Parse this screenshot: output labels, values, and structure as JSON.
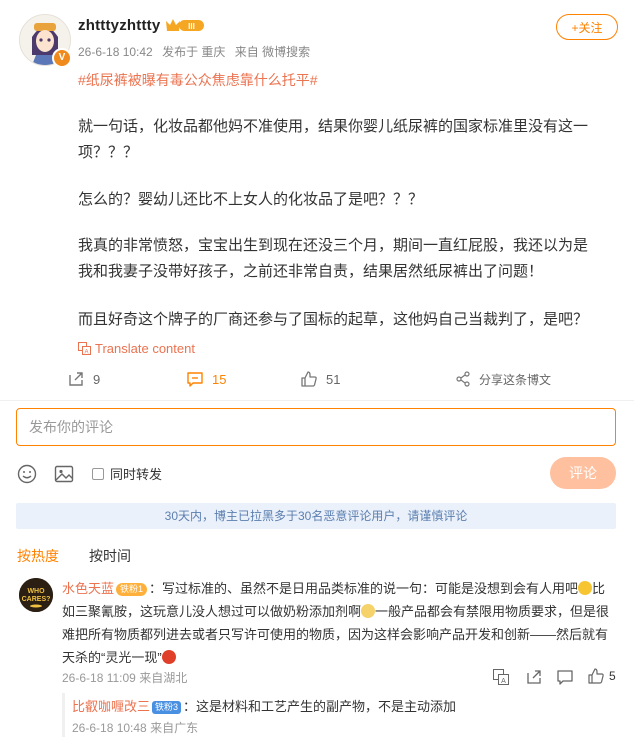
{
  "post": {
    "username": "zhtttyzhttty",
    "level_badge": "III",
    "verified_badge": "V",
    "date": "26-6-18 10:42",
    "location": "发布于 重庆",
    "source": "来自 微博搜索",
    "follow_label": "+关注",
    "hashtag": "#纸尿裤被曝有毒公众焦虑靠什么托平#",
    "paragraphs": [
      "就一句话，化妆品都他妈不准使用，结果你婴儿纸尿裤的国家标准里没有这一项？？？",
      "怎么的？婴幼儿还比不上女人的化妆品了是吧？？？",
      "我真的非常愤怒，宝宝出生到现在还没三个月，期间一直红屁股，我还以为是我和我妻子没带好孩子，之前还非常自责，结果居然纸尿裤出了问题！",
      "而且好奇这个牌子的厂商还参与了国标的起草，这他妈自己当裁判了，是吧？"
    ],
    "translate_label": "Translate content",
    "share_count": "9",
    "comment_count": "15",
    "like_count": "51",
    "share_weibo_label": "分享这条博文"
  },
  "composer": {
    "placeholder": "发布你的评论",
    "repost_label": "同时转发",
    "submit_label": "评论"
  },
  "notice": "30天内，博主已拉黑多于30名恶意评论用户，请谨慎评论",
  "sort": {
    "by_hot": "按热度",
    "by_time": "按时间"
  },
  "comments": [
    {
      "user": "水色天蓝",
      "badge": "铁粉1",
      "text": "：写过标准的、虽然不是日用品类标准的说一句：可能是没想到会有人用吧",
      "text2": "比如三聚氰胺，这玩意儿没人想过可以做奶粉添加剂啊",
      "text3": "一般产品都会有禁限用物质要求，但是很难把所有物质都列进去或者只写许可使用的物质，因为这样会影响产品开发和创新——然后就有天杀的“灵光一现”",
      "date": "26-6-18 11:09",
      "location": "来自湖北",
      "like_count": "5",
      "reply": {
        "user": "比叡咖喱改三",
        "badge": "铁粉3",
        "text": "：这是材料和工艺产生的副产物，不是主动添加",
        "date": "26-6-18 10:48",
        "location": "来自广东"
      }
    }
  ],
  "colors": {
    "accent": "#ff8200",
    "link": "#eb7350",
    "notice_bg": "#eaf1fa"
  }
}
